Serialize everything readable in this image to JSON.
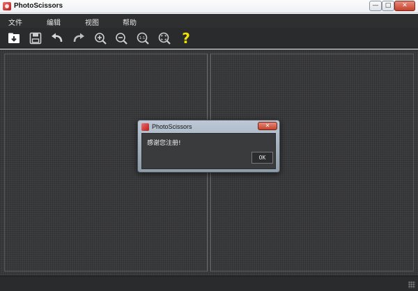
{
  "window": {
    "title": "PhotoScissors",
    "app_icon": "photoscissors-logo-icon",
    "controls": {
      "minimize": "—",
      "maximize": "□",
      "close": "✕"
    }
  },
  "menu": {
    "items": [
      {
        "label": "文件"
      },
      {
        "label": "编辑"
      },
      {
        "label": "视图"
      },
      {
        "label": "帮助"
      }
    ]
  },
  "toolbar": {
    "buttons": [
      {
        "icon": "open-folder-icon"
      },
      {
        "icon": "save-disk-icon"
      },
      {
        "icon": "undo-icon"
      },
      {
        "icon": "redo-icon"
      },
      {
        "icon": "zoom-in-icon"
      },
      {
        "icon": "zoom-out-icon"
      },
      {
        "icon": "zoom-actual-size-icon",
        "label": "1:1"
      },
      {
        "icon": "zoom-fit-icon"
      },
      {
        "icon": "help-icon",
        "label": "?"
      }
    ]
  },
  "colors": {
    "workspace": "#3d3e40",
    "help_accent": "#f2e200",
    "close_red": "#c4412b"
  },
  "dialog": {
    "title": "PhotoScissors",
    "message": "感谢您注册!",
    "ok_label": "OK",
    "close_glyph": "✕"
  }
}
